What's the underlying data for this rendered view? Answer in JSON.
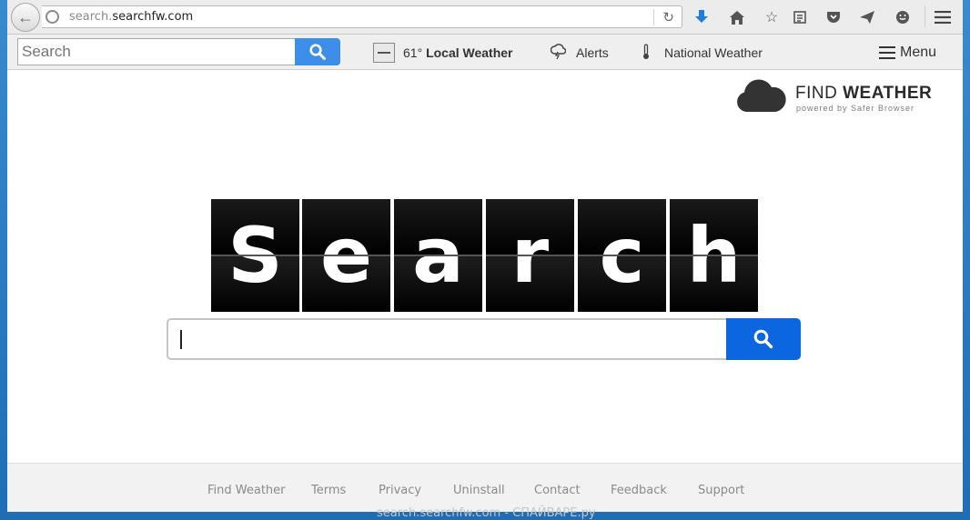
{
  "browser": {
    "url_prefix": "search.",
    "url_domain": "searchfw.com",
    "icons": [
      "back-icon",
      "globe-icon",
      "reload-icon",
      "download-icon",
      "home-icon",
      "bookmark-star-icon",
      "reading-list-icon",
      "pocket-icon",
      "send-icon",
      "chat-icon",
      "hamburger-icon"
    ]
  },
  "toolbar": {
    "search_placeholder": "Search",
    "temperature": "61°",
    "local_weather": "Local Weather",
    "alerts": "Alerts",
    "national_weather": "National Weather",
    "menu": "Menu"
  },
  "brand": {
    "name_light": "FIND ",
    "name_bold": "WEATHER",
    "tagline": "powered by Safer Browser"
  },
  "logo": {
    "letters": [
      "S",
      "e",
      "a",
      "r",
      "c",
      "h"
    ]
  },
  "footer": {
    "links": [
      "Find Weather",
      "Terms",
      "Privacy",
      "Uninstall",
      "Contact",
      "Feedback",
      "Support"
    ],
    "watermark": "search.searchfw.com - СПАЙВАРЕ.ру"
  },
  "colors": {
    "search_button": "#0b66e0",
    "toolbar_search_button": "#3d8ee8",
    "window_frame": "#2f7fc4"
  }
}
